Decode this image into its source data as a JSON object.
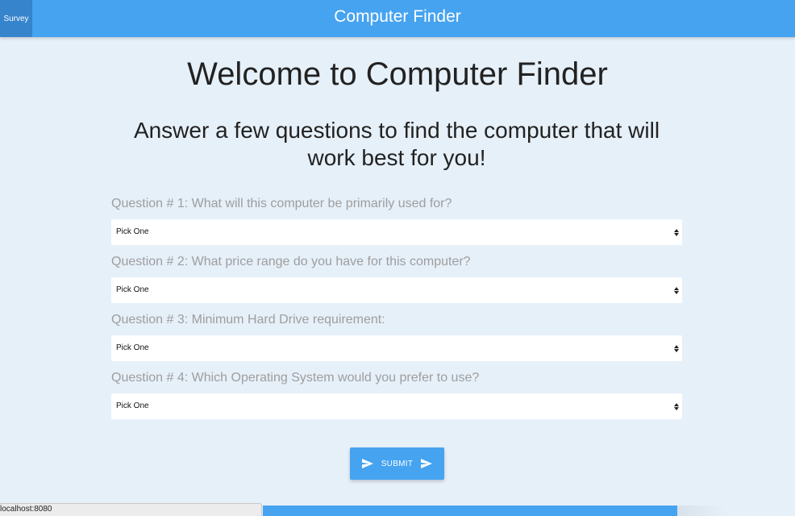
{
  "navbar": {
    "brand_button": "Survey",
    "title": "Computer Finder"
  },
  "header": {
    "title": "Welcome to Computer Finder",
    "subtitle": "Answer a few questions to find the computer that will work best for you!"
  },
  "questions": [
    {
      "label": "Question # 1: What will this computer be primarily used for?",
      "selected": "Pick One"
    },
    {
      "label": "Question # 2: What price range do you have for this computer?",
      "selected": "Pick One"
    },
    {
      "label": "Question # 3: Minimum Hard Drive requirement:",
      "selected": "Pick One"
    },
    {
      "label": "Question # 4: Which Operating System would you prefer to use?",
      "selected": "Pick One"
    }
  ],
  "submit": {
    "label": "SUBMIT",
    "icon": "send-icon"
  },
  "status_bar": {
    "url": "localhost:8080"
  },
  "colors": {
    "primary": "#45a3f0",
    "primary_dark": "#3584cc",
    "background": "#e6f0f9",
    "question_text": "#9e9e9e"
  }
}
